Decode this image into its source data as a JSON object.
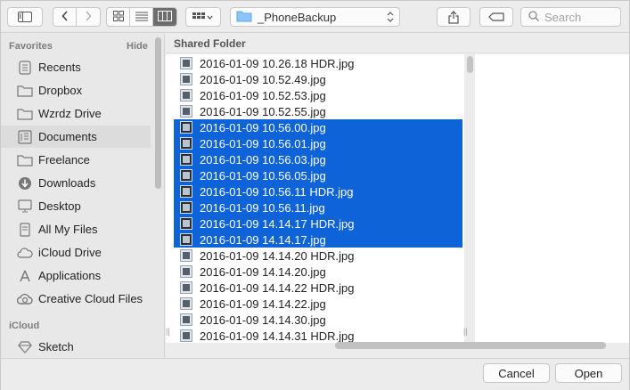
{
  "toolbar": {
    "location": "_PhoneBackup",
    "search_placeholder": "Search"
  },
  "sidebar": {
    "favorites_header": "Favorites",
    "hide_label": "Hide",
    "items": [
      {
        "label": "Recents",
        "icon": "recents-icon"
      },
      {
        "label": "Dropbox",
        "icon": "folder-icon"
      },
      {
        "label": "Wzrdz Drive",
        "icon": "folder-icon"
      },
      {
        "label": "Documents",
        "icon": "documents-icon"
      },
      {
        "label": "Freelance",
        "icon": "folder-icon"
      },
      {
        "label": "Downloads",
        "icon": "downloads-icon"
      },
      {
        "label": "Desktop",
        "icon": "desktop-icon"
      },
      {
        "label": "All My Files",
        "icon": "all-files-icon"
      },
      {
        "label": "iCloud Drive",
        "icon": "cloud-icon"
      },
      {
        "label": "Applications",
        "icon": "applications-icon"
      },
      {
        "label": "Creative Cloud Files",
        "icon": "creative-cloud-icon"
      }
    ],
    "icloud_header": "iCloud",
    "icloud_items": [
      {
        "label": "Sketch",
        "icon": "sketch-icon"
      }
    ]
  },
  "column": {
    "header": "Shared Folder",
    "files": [
      {
        "name": "2016-01-09 10.26.18 HDR.jpg",
        "selected": false
      },
      {
        "name": "2016-01-09 10.52.49.jpg",
        "selected": false
      },
      {
        "name": "2016-01-09 10.52.53.jpg",
        "selected": false
      },
      {
        "name": "2016-01-09 10.52.55.jpg",
        "selected": false
      },
      {
        "name": "2016-01-09 10.56.00.jpg",
        "selected": true
      },
      {
        "name": "2016-01-09 10.56.01.jpg",
        "selected": true
      },
      {
        "name": "2016-01-09 10.56.03.jpg",
        "selected": true
      },
      {
        "name": "2016-01-09 10.56.05.jpg",
        "selected": true
      },
      {
        "name": "2016-01-09 10.56.11 HDR.jpg",
        "selected": true
      },
      {
        "name": "2016-01-09 10.56.11.jpg",
        "selected": true
      },
      {
        "name": "2016-01-09 14.14.17 HDR.jpg",
        "selected": true
      },
      {
        "name": "2016-01-09 14.14.17.jpg",
        "selected": true
      },
      {
        "name": "2016-01-09 14.14.20 HDR.jpg",
        "selected": false
      },
      {
        "name": "2016-01-09 14.14.20.jpg",
        "selected": false
      },
      {
        "name": "2016-01-09 14.14.22 HDR.jpg",
        "selected": false
      },
      {
        "name": "2016-01-09 14.14.22.jpg",
        "selected": false
      },
      {
        "name": "2016-01-09 14.14.30.jpg",
        "selected": false
      },
      {
        "name": "2016-01-09 14.14.31 HDR.jpg",
        "selected": false
      }
    ]
  },
  "footer": {
    "cancel_label": "Cancel",
    "open_label": "Open"
  },
  "colors": {
    "selection": "#0e63d8",
    "folder": "#5aa9f0"
  }
}
